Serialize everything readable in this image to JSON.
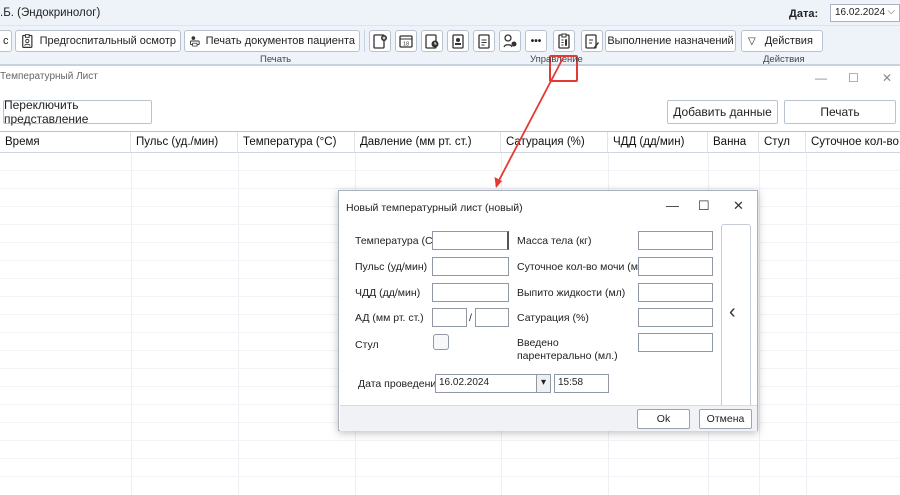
{
  "header": {
    "doctor": ".Б. (Эндокринолог)",
    "date_label": "Дата:",
    "date_value": "16.02.2024",
    "date_dropdown_icon": "chevron-down-icon"
  },
  "ribbon": {
    "buttons": {
      "partial_left": "с",
      "predhosp": "Предгоспитальный осмотр",
      "print_docs": "Печать документов пациента",
      "more": "•••",
      "execute": "Выполнение назначений",
      "actions": "Действия"
    },
    "groups": {
      "print": "Печать",
      "manage": "Управление",
      "actions": "Действия"
    },
    "icons": [
      "clipboard-person-icon",
      "printer-person-icon",
      "clipboard-plus-icon",
      "calendar-icon",
      "clipboard-clock-icon",
      "clipboard-badge-icon",
      "clipboard-list-icon",
      "clipboard-gear-icon",
      "more-icon",
      "temperature-sheet-icon",
      "clipboard-edit-icon",
      "triangle-down-icon"
    ],
    "accent": "#e53935"
  },
  "window": {
    "title": "Температурный Лист",
    "minimize": "—",
    "maximize": "☐",
    "close": "✕",
    "switch_view": "Переключить представление",
    "add_data": "Добавить данные",
    "print": "Печать"
  },
  "table": {
    "columns": [
      "Время",
      "Пульс (уд./мин)",
      "Температура (°C)",
      "Давление (мм рт. ст.)",
      "Сатурация (%)",
      "ЧДД (дд/мин)",
      "Ванна",
      "Стул",
      "Суточное кол-во м"
    ]
  },
  "dialog": {
    "title": "Новый температурный лист (новый)",
    "minimize": "—",
    "maximize": "☐",
    "close": "✕",
    "fields_left": {
      "temperature": "Температура (С°)",
      "pulse": "Пульс (уд/мин)",
      "rr": "ЧДД (дд/мин)",
      "bp": "АД (мм рт. ст.)",
      "bp_sep": "/",
      "stool": "Стул"
    },
    "fields_right": {
      "weight": "Масса тела (кг)",
      "urine": "Суточное кол-во мочи (мл)",
      "fluid": "Выпито жидкости (мл)",
      "saturation": "Сатурация (%)",
      "parenteral": "Введено парентерально (мл.)"
    },
    "date_label": "Дата проведения",
    "date_value": "16.02.2024",
    "date_dropdown": "▾",
    "time_value": "15:58",
    "side_arrow": "‹",
    "ok": "Ok",
    "cancel": "Отмена"
  }
}
